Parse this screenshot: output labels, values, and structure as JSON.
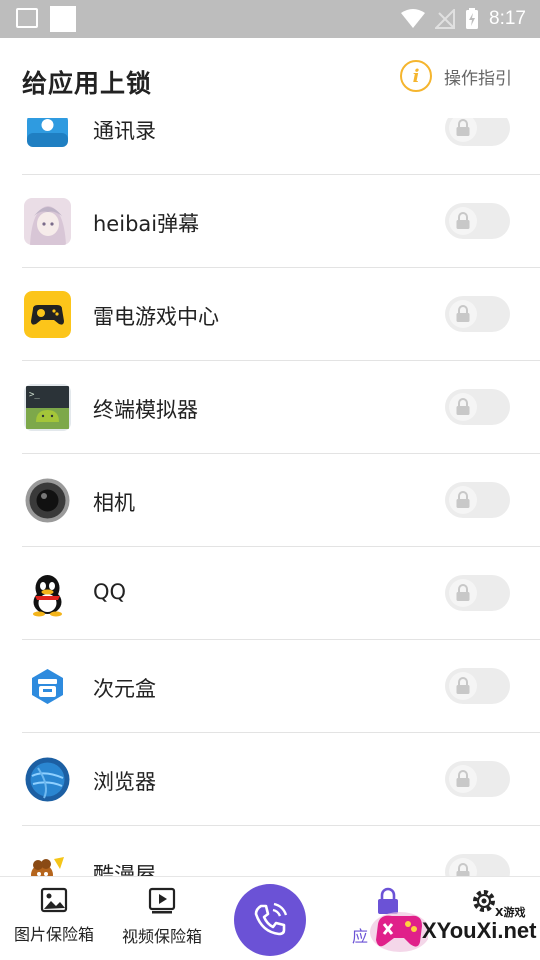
{
  "status_bar": {
    "time": "8:17"
  },
  "header": {
    "title": "给应用上锁",
    "guide_label": "操作指引"
  },
  "apps": [
    {
      "name": "通讯录",
      "icon": "contacts-icon",
      "locked": false
    },
    {
      "name": "heibai弹幕",
      "icon": "heibai-danmu-icon",
      "locked": false
    },
    {
      "name": "雷电游戏中心",
      "icon": "gamepad-icon",
      "locked": false
    },
    {
      "name": "终端模拟器",
      "icon": "terminal-android-icon",
      "locked": false
    },
    {
      "name": "相机",
      "icon": "camera-lens-icon",
      "locked": false
    },
    {
      "name": "QQ",
      "icon": "qq-penguin-icon",
      "locked": false
    },
    {
      "name": "次元盒",
      "icon": "ciyuanhe-icon",
      "locked": false
    },
    {
      "name": "浏览器",
      "icon": "browser-globe-icon",
      "locked": false
    },
    {
      "name": "酷漫屋",
      "icon": "kumanwu-icon",
      "locked": false
    }
  ],
  "bottom_nav": {
    "photo_vault": "图片保险箱",
    "video_vault": "视频保险箱",
    "app_lock": "应",
    "settings": ""
  },
  "watermark": {
    "brand": "XYouXi.net",
    "tag": "X游戏"
  },
  "colors": {
    "accent": "#6b52d6",
    "info": "#f5b52e",
    "lock_grey": "#c8c8c8"
  }
}
